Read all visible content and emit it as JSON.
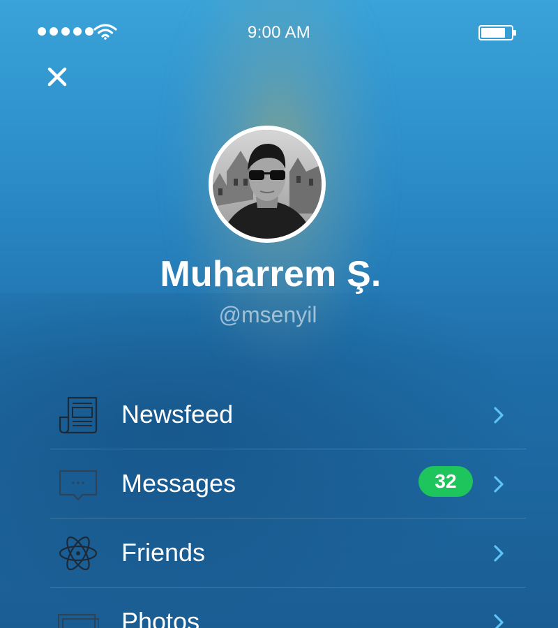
{
  "status_bar": {
    "time": "9:00 AM",
    "signal_dots": 5,
    "signal_icon": "signal-dots-icon",
    "wifi_icon": "wifi-icon",
    "battery_icon": "battery-icon",
    "battery_level": 0.8
  },
  "header": {
    "close_icon": "close-icon"
  },
  "profile": {
    "name": "Muharrem Ş.",
    "handle": "@msenyil",
    "avatar_icon": "avatar-photo"
  },
  "menu": {
    "items": [
      {
        "label": "Newsfeed",
        "icon": "newspaper-icon",
        "badge": null
      },
      {
        "label": "Messages",
        "icon": "chat-bubble-icon",
        "badge": "32"
      },
      {
        "label": "Friends",
        "icon": "atom-icon",
        "badge": null
      },
      {
        "label": "Photos",
        "icon": "photos-icon",
        "badge": null
      }
    ]
  },
  "colors": {
    "background_top": "#3aa3d8",
    "background_bottom": "#1a5d93",
    "badge_green": "#1ec45c",
    "chevron_blue": "#5ec3f5",
    "icon_dark": "#1c2a38"
  }
}
